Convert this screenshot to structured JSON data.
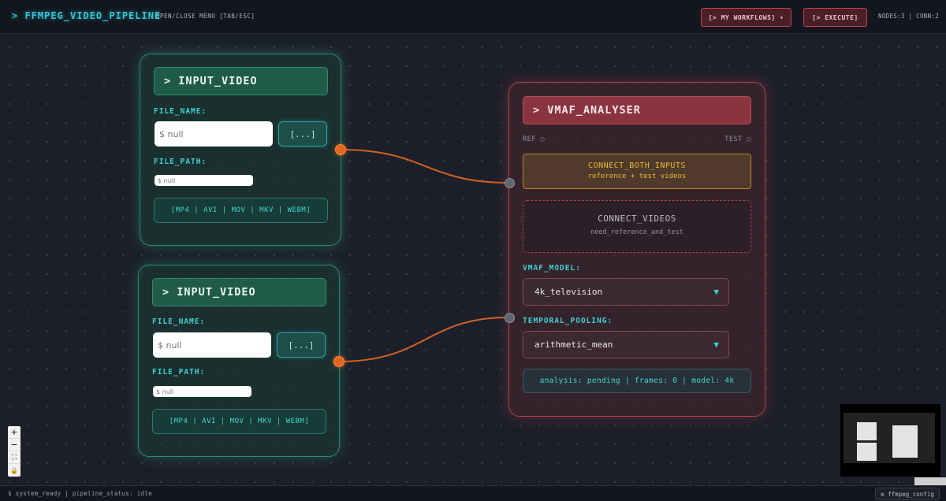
{
  "app": {
    "title": "> FFMPEG_VIDEO_PIPELINE",
    "menu_hint": "OPEN/CLOSE MENU [TAB/ESC]",
    "workflows_button": "[> MY WORKFLOWS] ▾",
    "execute_button": "[> EXECUTE]",
    "stats": "NODES:3 | CONN:2"
  },
  "input_nodes": [
    {
      "title": "> INPUT_VIDEO",
      "file_name_label": "FILE_NAME:",
      "file_name_placeholder": "$ null",
      "browse_label": "[...]",
      "file_path_label": "FILE_PATH:",
      "file_path_placeholder": "$ null",
      "formats": "[MP4 | AVI | MOV | MKV | WEBM]"
    },
    {
      "title": "> INPUT_VIDEO",
      "file_name_label": "FILE_NAME:",
      "file_name_placeholder": "$ null",
      "browse_label": "[...]",
      "file_path_label": "FILE_PATH:",
      "file_path_placeholder": "$ null",
      "formats": "[MP4 | AVI | MOV | MKV | WEBM]"
    }
  ],
  "vmaf_node": {
    "title": "> VMAF_ANALYSER",
    "ref_label": "REF ○",
    "test_label": "TEST ○",
    "warning_title": "CONNECT_BOTH_INPUTS",
    "warning_sub": "reference + test videos",
    "placeholder_title": "CONNECT_VIDEOS",
    "placeholder_sub": "need_reference_and_test",
    "model_label": "VMAF_MODEL:",
    "model_value": "4k_television",
    "pooling_label": "TEMPORAL_POOLING:",
    "pooling_value": "arithmetic_mean",
    "status": "analysis: pending | frames: 0 | model: 4k"
  },
  "controls": {
    "zoom_in": "+",
    "zoom_out": "−",
    "fit": "⛶",
    "lock": "🔒"
  },
  "footer": {
    "status": "$ system_ready | pipeline_status: idle",
    "config_button": "⚙ ffmpeg_config"
  },
  "colors": {
    "accent_cyan": "#2fc7d6",
    "input_node_border": "#2c8a6d",
    "vmaf_node_border": "#a8434d",
    "edge": "#e2661f",
    "warning": "#e8b936"
  }
}
